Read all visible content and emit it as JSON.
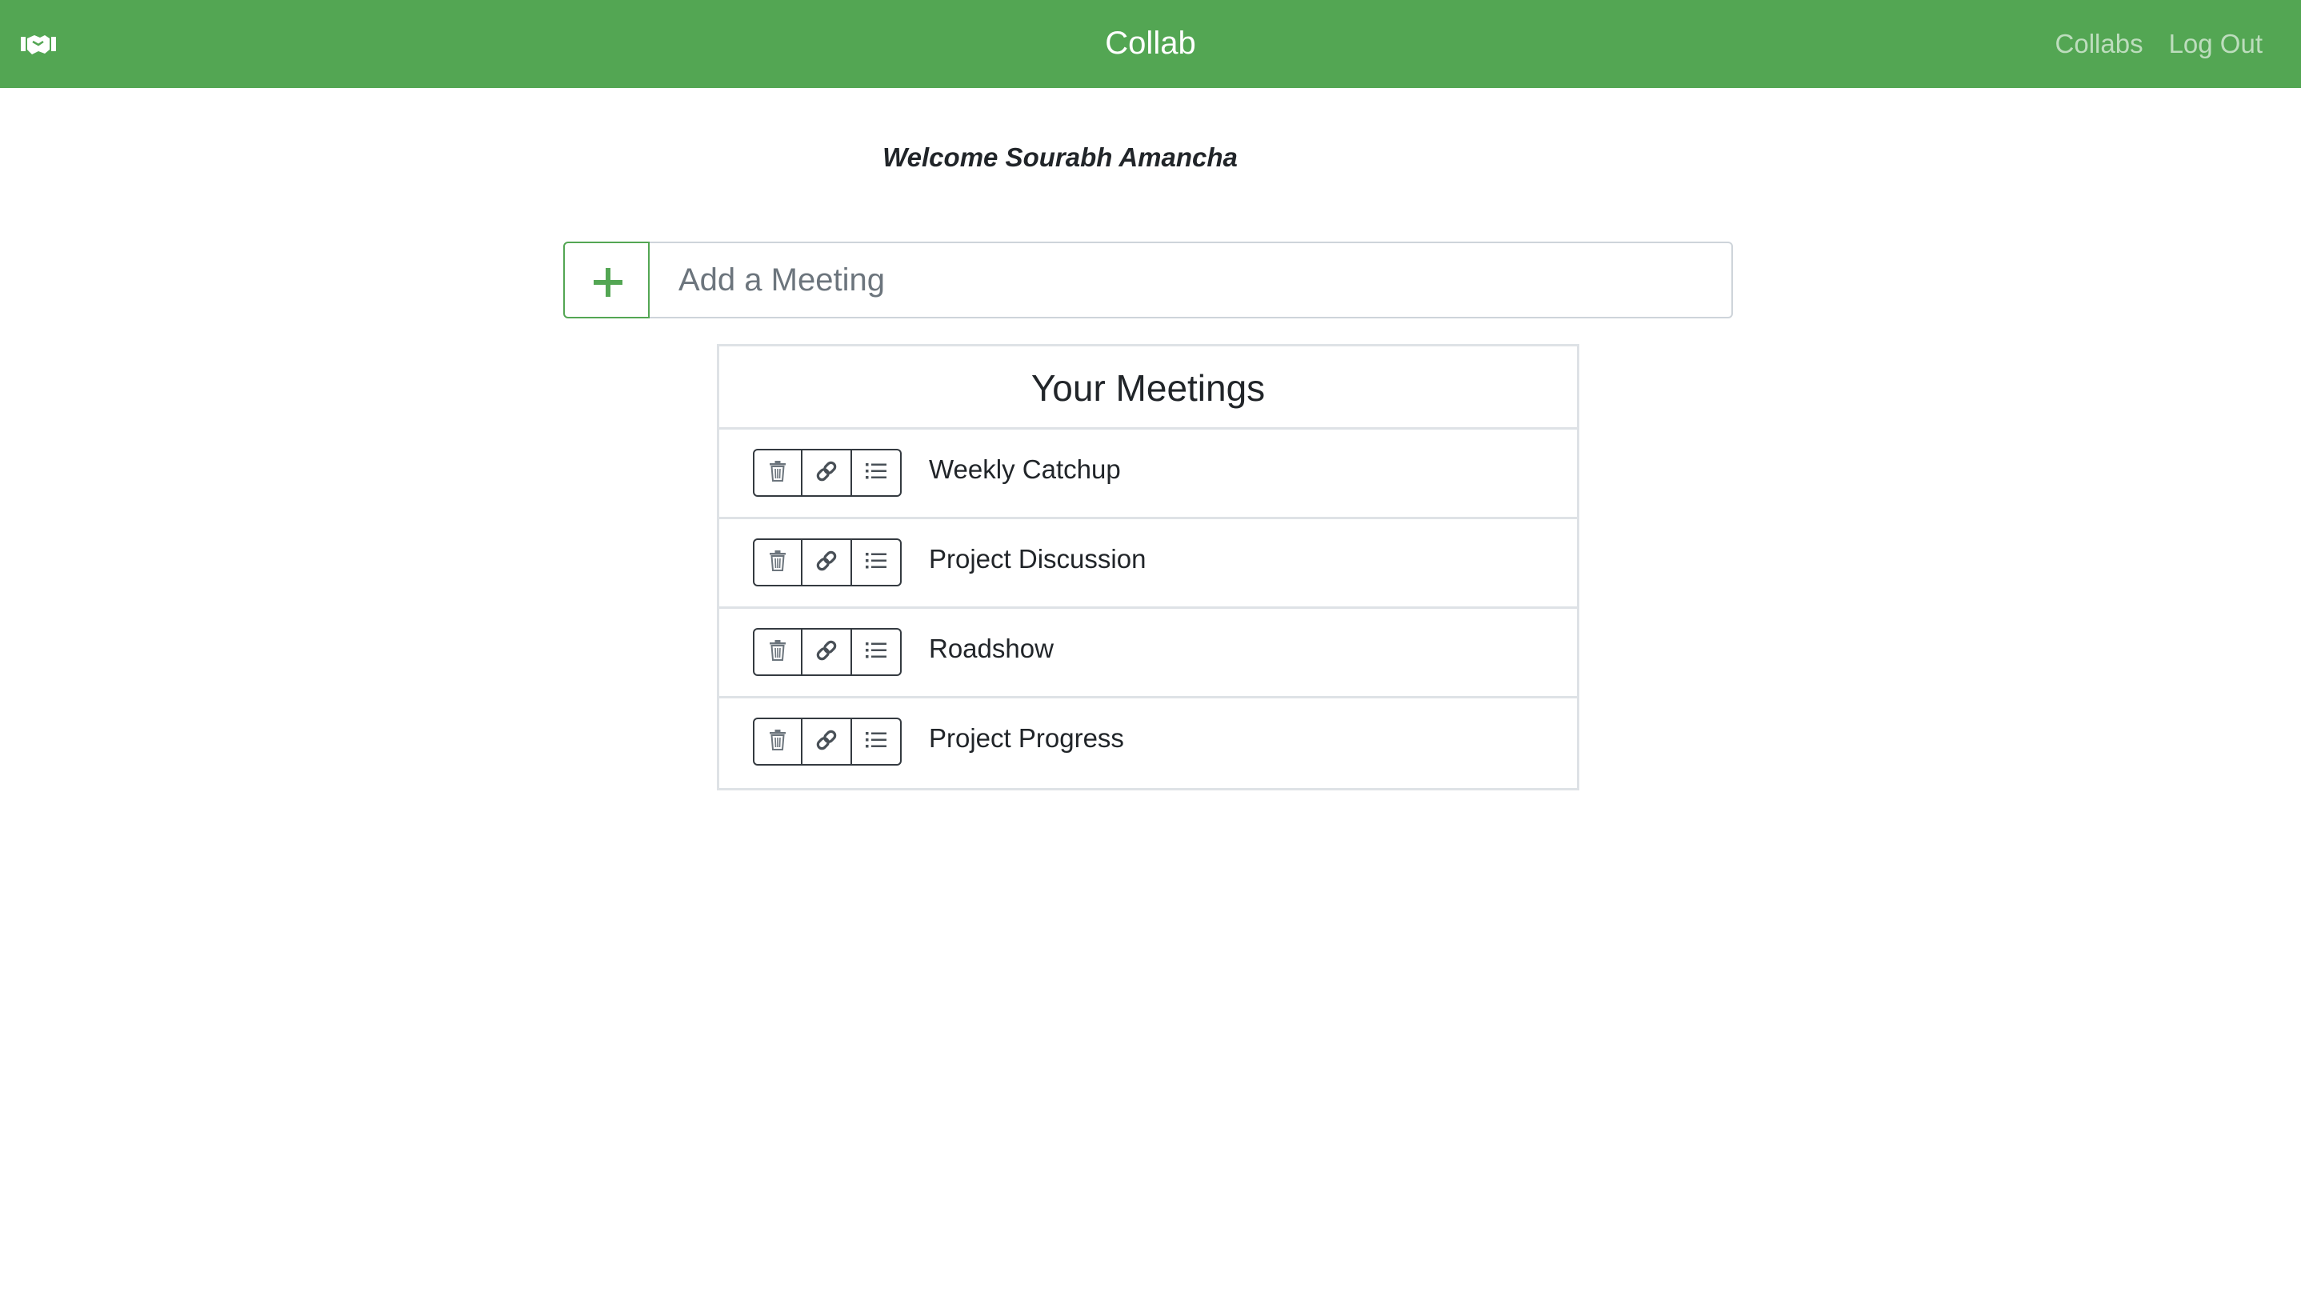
{
  "navbar": {
    "brand_icon": "handshake-icon",
    "title": "Collab",
    "links": [
      "Collabs",
      "Log Out"
    ],
    "background": "#53a653"
  },
  "welcome": "Welcome Sourabh Amancha",
  "add_meeting": {
    "button_icon": "plus-icon",
    "placeholder": "Add a Meeting",
    "value": ""
  },
  "meetings": {
    "header": "Your Meetings",
    "actions": [
      "trash-icon",
      "link-icon",
      "list-icon"
    ],
    "items": [
      "Weekly Catchup",
      "Project Discussion",
      "Roadshow",
      "Project Progress"
    ]
  }
}
